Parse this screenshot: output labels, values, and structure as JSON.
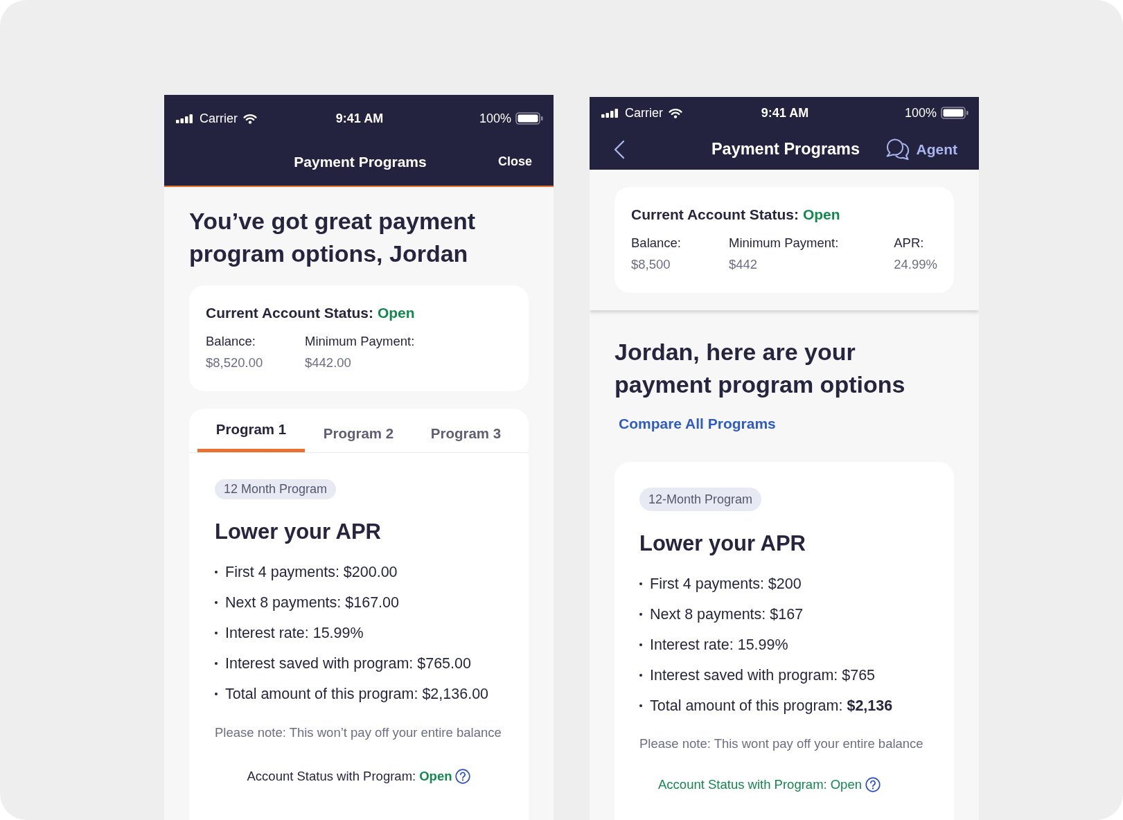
{
  "screens": [
    {
      "kind": "modal",
      "status_bar": {
        "carrier": "Carrier",
        "time": "9:41 AM",
        "battery": "100%"
      },
      "nav_bar": {
        "title": "Payment Programs",
        "action": {
          "kind": "plain",
          "label": "Close"
        }
      },
      "heading": "You’ve got great payment program options, Jordan",
      "account_card": {
        "title": "Current Account Status:",
        "status": "Open",
        "fields": [
          {
            "label": "Balance:",
            "value": "$8,520.00"
          },
          {
            "label": "Minimum Payment:",
            "value": "$442.00"
          }
        ]
      },
      "tabs": [
        {
          "label": "Program 1",
          "selected": true
        },
        {
          "label": "Program 2",
          "selected": false
        },
        {
          "label": "Program 3",
          "selected": false
        }
      ],
      "program": {
        "tag": "12 Month Program",
        "title": "Lower your APR",
        "details": [
          "First 4 payments: $200.00",
          "Next 8 payments: $167.00",
          "Interest rate: 15.99%",
          "Interest saved with program: $765.00",
          "Total amount of this program: $2,136.00"
        ],
        "note": "Please note: This won’t pay off your entire balance",
        "status_row": {
          "label": "Account Status with Program:",
          "value": "Open",
          "highlighted": false
        }
      }
    },
    {
      "kind": "page",
      "status_bar": {
        "carrier": "Carrier",
        "time": "9:41 AM",
        "battery": "100%"
      },
      "nav_bar": {
        "back": true,
        "title": "Payment Programs",
        "action": {
          "kind": "with_icon",
          "label": "Agent"
        }
      },
      "account_card": {
        "title": "Current Account Status:",
        "status": "Open",
        "fields": [
          {
            "label": "Balance:",
            "value": "$8,500"
          },
          {
            "label": "Minimum Payment:",
            "value": "$442"
          },
          {
            "label": "APR:",
            "value": "24.99%"
          }
        ]
      },
      "heading": "Jordan, here are your payment program options",
      "link": "Compare All Programs",
      "program": {
        "tag": "12-Month Program",
        "title": "Lower your APR",
        "details": [
          "First 4 payments: $200",
          "Next 8 payments: $167",
          "Interest rate: 15.99%",
          "Interest saved with program: $765",
          "Total amount of this program: **$2,136**"
        ],
        "note": "Please note: This wont pay off your entire balance",
        "status_row": {
          "label": "Account Status with Program:",
          "value": "Open",
          "highlighted": true
        }
      }
    }
  ]
}
